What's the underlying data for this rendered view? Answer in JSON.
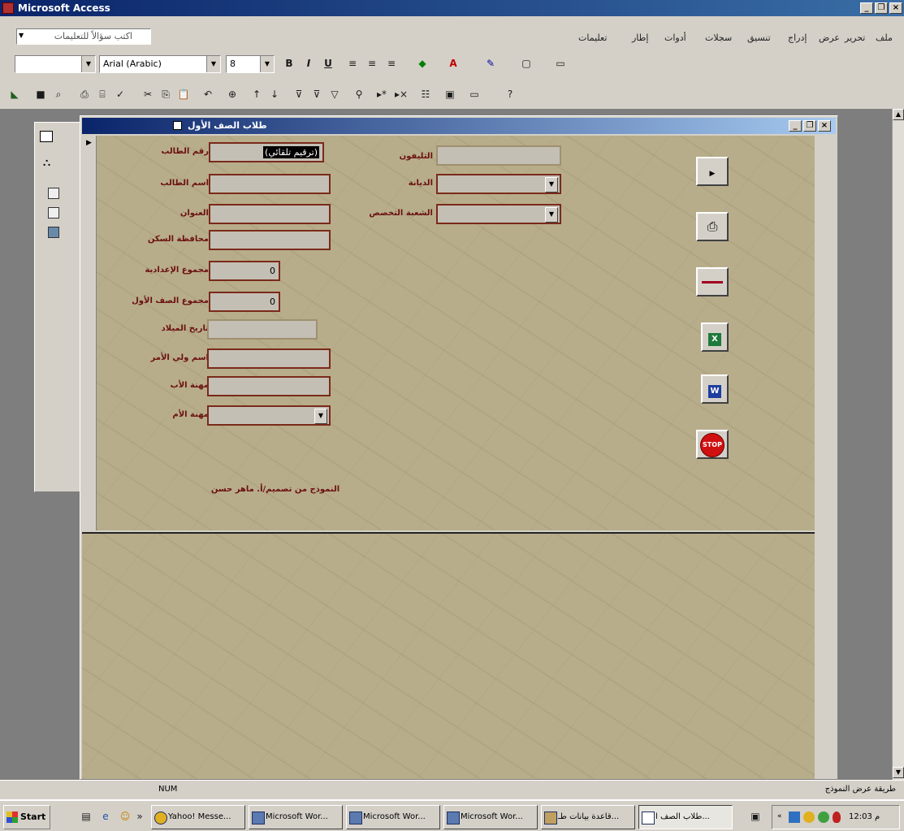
{
  "app": {
    "title": "Microsoft Access"
  },
  "menu": {
    "items": [
      "ملف",
      "تحرير",
      "عرض",
      "إدراج",
      "تنسيق",
      "سجلات",
      "أدوات",
      "إطار",
      "تعليمات"
    ],
    "ask_placeholder": "اكتب سؤالاً للتعليمات"
  },
  "format_toolbar": {
    "font": "Arial (Arabic)",
    "size": "8",
    "bold": "B",
    "italic": "I",
    "underline": "U"
  },
  "form": {
    "title": "طلاب الصف الأول",
    "fields_left": [
      {
        "label": "رقم الطالب",
        "value": "(ترقيم تلقائي)"
      },
      {
        "label": "اسم الطالب",
        "value": ""
      },
      {
        "label": "العنوان",
        "value": ""
      },
      {
        "label": "محافظة السكن",
        "value": ""
      },
      {
        "label": "مجموع الإعدادية",
        "value": "0"
      },
      {
        "label": "مجموع الصف الأول",
        "value": "0"
      },
      {
        "label": "تاريخ الميلاد",
        "value": ""
      },
      {
        "label": "اسم ولي الأمر",
        "value": ""
      },
      {
        "label": "مهنة الأب",
        "value": ""
      },
      {
        "label": "مهنة الأم",
        "value": ""
      }
    ],
    "fields_right": [
      {
        "label": "التليفون",
        "value": ""
      },
      {
        "label": "الديانة",
        "value": ""
      },
      {
        "label": "الشعبة التخصص",
        "value": ""
      }
    ],
    "credit": "النموذج من تصميم/أ. ماهر حسن",
    "side_buttons": [
      "next-record",
      "print",
      "separator",
      "excel",
      "word",
      "stop"
    ],
    "stop_label": "STOP"
  },
  "status": {
    "left": "طريقة عرض النموذج",
    "num": "NUM"
  },
  "taskbar": {
    "start": "Start",
    "tasks": [
      "Yahoo! Messe...",
      "Microsoft Wor...",
      "Microsoft Wor...",
      "Microsoft Wor...",
      "قاعدة بيانات طـ...",
      "طلاب الصف ا..."
    ],
    "clock": "12:03 م"
  }
}
